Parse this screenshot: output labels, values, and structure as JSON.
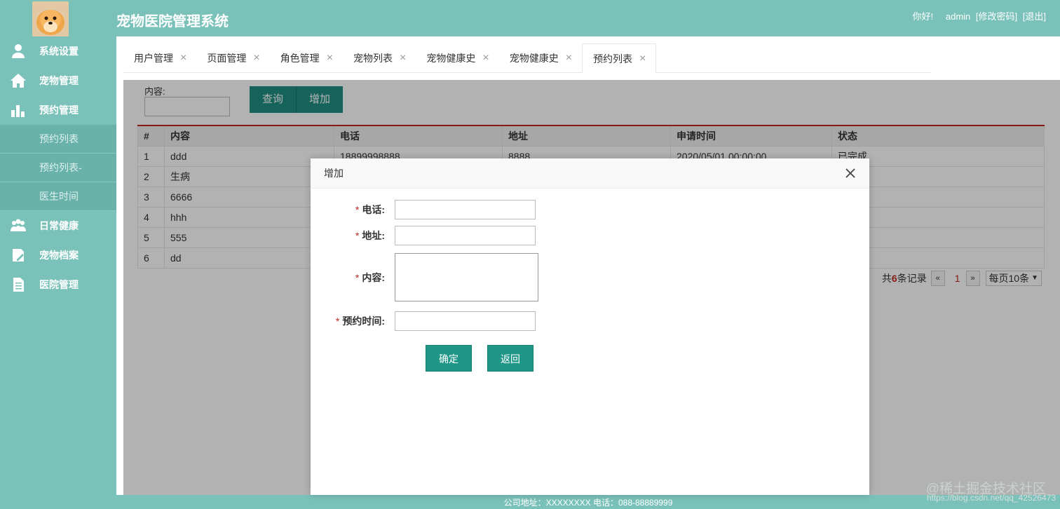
{
  "app": {
    "title": "宠物医院管理系统",
    "greeting": "你好!",
    "username": "admin",
    "change_password": "[修改密码]",
    "logout": "[退出]"
  },
  "sidebar": {
    "items": [
      {
        "label": "系统设置",
        "icon": "user-settings-icon"
      },
      {
        "label": "宠物管理",
        "icon": "home-icon"
      },
      {
        "label": "预约管理",
        "icon": "bar-chart-icon"
      }
    ],
    "sub_items": [
      {
        "label": "预约列表"
      },
      {
        "label": "预约列表-"
      },
      {
        "label": "医生时间"
      }
    ],
    "items_after": [
      {
        "label": "日常健康",
        "icon": "group-icon"
      },
      {
        "label": "宠物档案",
        "icon": "edit-doc-icon"
      },
      {
        "label": "医院管理",
        "icon": "document-icon"
      }
    ]
  },
  "tabs": [
    {
      "label": "用户管理"
    },
    {
      "label": "页面管理"
    },
    {
      "label": "角色管理"
    },
    {
      "label": "宠物列表"
    },
    {
      "label": "宠物健康史"
    },
    {
      "label": "宠物健康史"
    },
    {
      "label": "预约列表",
      "active": true
    }
  ],
  "search": {
    "label": "内容:",
    "query_button": "查询",
    "add_button": "增加"
  },
  "table": {
    "columns": [
      "#",
      "内容",
      "电话",
      "地址",
      "申请时间",
      "状态"
    ],
    "rows": [
      [
        "1",
        "ddd",
        "18899998888",
        "8888",
        "2020/05/01 00:00:00",
        "已完成"
      ],
      [
        "2",
        "生病",
        "",
        "",
        "",
        ""
      ],
      [
        "3",
        "6666",
        "",
        "",
        "",
        ""
      ],
      [
        "4",
        "hhh",
        "",
        "",
        "",
        ""
      ],
      [
        "5",
        "555",
        "",
        "",
        "",
        ""
      ],
      [
        "6",
        "dd",
        "",
        "",
        "",
        ""
      ]
    ]
  },
  "pager": {
    "prefix": "共",
    "count": "6",
    "suffix": "条记录",
    "prev": "«",
    "page": "1",
    "next": "»",
    "page_size": "每页10条"
  },
  "modal": {
    "title": "增加",
    "phone_label": "电话:",
    "address_label": "地址:",
    "content_label": "内容:",
    "time_label": "预约时间:",
    "required_mark": "*",
    "confirm_button": "确定",
    "back_button": "返回"
  },
  "footer": {
    "text": "公司地址：XXXXXXXX 电话：088-88889999"
  },
  "watermark": {
    "text": "@稀土掘金技术社区",
    "url": "https://blog.csdn.net/qq_42526473"
  },
  "colors": {
    "primary": "#7ac2b9",
    "button": "#1f8f82",
    "accent_red": "#c0281f"
  }
}
